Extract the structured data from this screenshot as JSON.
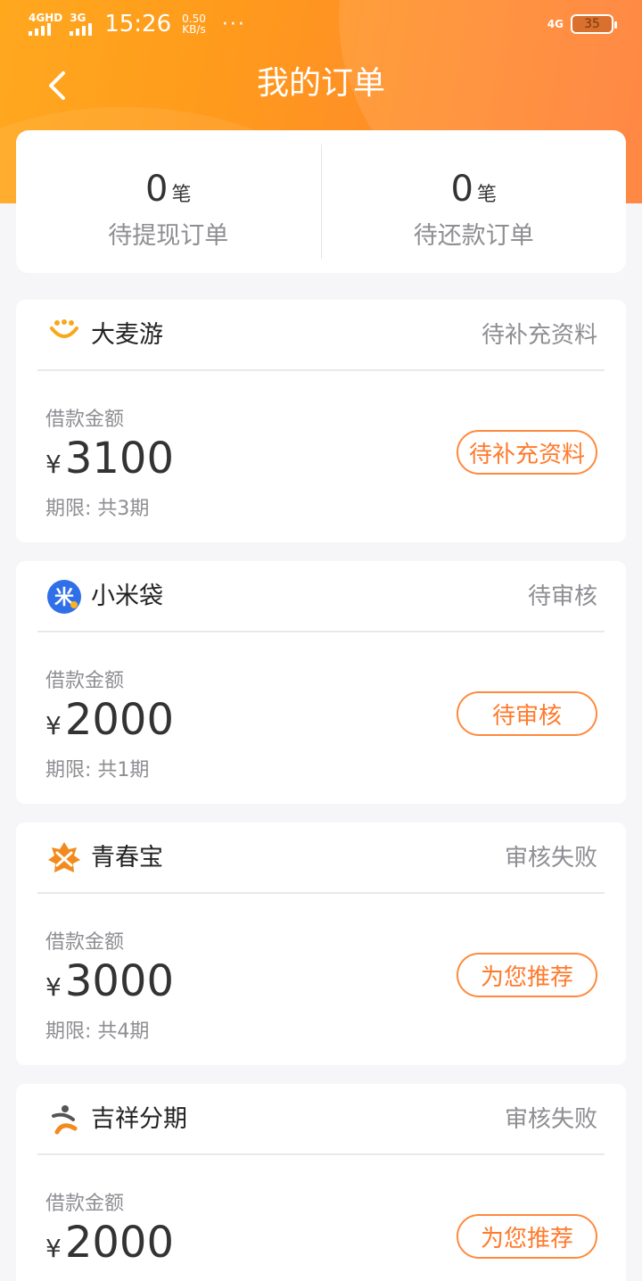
{
  "status_bar": {
    "sim1": "4GHD",
    "sim2": "3G",
    "time": "15:26",
    "speed_value": "0.50",
    "speed_unit": "KB/s",
    "more": "···",
    "network": "4G",
    "battery": "35"
  },
  "header": {
    "back_icon": "chevron-left-icon",
    "title": "我的订单"
  },
  "summary": {
    "withdraw_count": "0",
    "withdraw_unit": "笔",
    "withdraw_label": "待提现订单",
    "repay_count": "0",
    "repay_unit": "笔",
    "repay_label": "待还款订单"
  },
  "orders": [
    {
      "brand": "大麦游",
      "logo_text": "大麦游",
      "status": "待补充资料",
      "amount_label": "借款金额",
      "currency": "¥",
      "amount": "3100",
      "term": "期限: 共3期",
      "action": "待补充资料"
    },
    {
      "brand": "小米袋",
      "logo_text": "米",
      "status": "待审核",
      "amount_label": "借款金额",
      "currency": "¥",
      "amount": "2000",
      "term": "期限: 共1期",
      "action": "待审核"
    },
    {
      "brand": "青春宝",
      "logo_text": "",
      "status": "审核失败",
      "amount_label": "借款金额",
      "currency": "¥",
      "amount": "3000",
      "term": "期限: 共4期",
      "action": "为您推荐"
    },
    {
      "brand": "吉祥分期",
      "logo_text": "",
      "status": "审核失败",
      "amount_label": "借款金额",
      "currency": "¥",
      "amount": "2000",
      "term": "",
      "action": "为您推荐"
    }
  ],
  "colors": {
    "accent": "#ff7a2c",
    "header_start": "#ffa81e",
    "header_end": "#ff7a30",
    "muted_text": "#8e8e93"
  }
}
